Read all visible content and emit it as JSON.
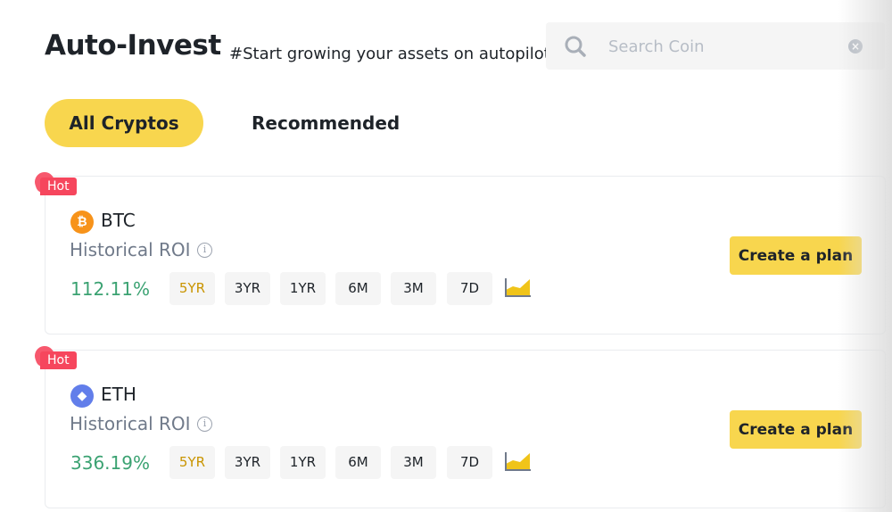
{
  "header": {
    "title": "Auto-Invest",
    "tagline": "#Start growing your assets on autopilot"
  },
  "search": {
    "placeholder": "Search Coin",
    "value": "",
    "icon": "search-icon",
    "clear_icon": "clear-icon"
  },
  "tabs": [
    {
      "label": "All Cryptos",
      "active": true
    },
    {
      "label": "Recommended",
      "active": false
    }
  ],
  "colors": {
    "accent": "#f8d64e",
    "hot": "#f6465d",
    "positive": "#3ba272",
    "active_period": "#c99400"
  },
  "cards": [
    {
      "badge": "Hot",
      "coin": "BTC",
      "coin_symbol": "₿",
      "roi_label": "Historical ROI",
      "roi_value": "112.11%",
      "periods": [
        "5YR",
        "3YR",
        "1YR",
        "6M",
        "3M",
        "7D"
      ],
      "selected_period": "5YR",
      "button": "Create a plan"
    },
    {
      "badge": "Hot",
      "coin": "ETH",
      "coin_symbol": "◆",
      "roi_label": "Historical ROI",
      "roi_value": "336.19%",
      "periods": [
        "5YR",
        "3YR",
        "1YR",
        "6M",
        "3M",
        "7D"
      ],
      "selected_period": "5YR",
      "button": "Create a plan"
    }
  ]
}
